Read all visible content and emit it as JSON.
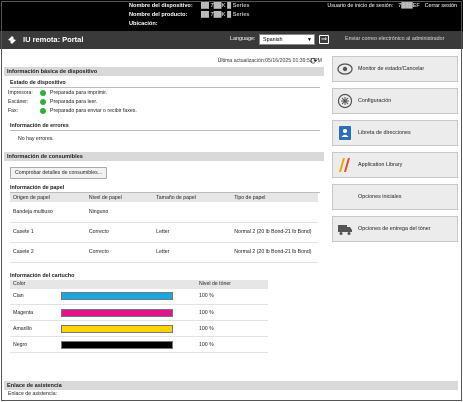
{
  "header": {
    "device_name_label": "Nombre del dispositivo:",
    "device_name_value": "██ 7██K █ Series",
    "product_name_label": "Nombre del producto:",
    "product_name_value": "██ 7██K █ Series",
    "location_label": "Ubicación:",
    "login_user_label": "Usuario de inicio de sesión:",
    "login_user_value": "7███EF",
    "logout_link": "Cerrar sesión"
  },
  "titlebar": {
    "title": "IU remota: Portal",
    "language_label": "Language:",
    "language_value": "Spanish",
    "mail_admin": "Enviar correo electrónico al administrador"
  },
  "update": {
    "text": "Última actualización:05/16/2025 01:39:51 PM"
  },
  "device_info": {
    "heading": "Información básica de dispositivo",
    "status_heading": "Estado de dispositivo",
    "rows": [
      {
        "label": "Impresora:",
        "value": "Preparada para imprimir."
      },
      {
        "label": "Escáner:",
        "value": "Preparada para leer."
      },
      {
        "label": "Fax:",
        "value": "Preparado para enviar o recibir faxes."
      }
    ],
    "errors_heading": "Información de errores",
    "errors_value": "No hay errores."
  },
  "consumables": {
    "heading": "Información de consumibles",
    "check_button": "Comprobar detalles de consumibles...",
    "paper_heading": "Información de papel",
    "paper_columns": [
      "Origen de papel",
      "Nivel de papel",
      "Tamaño de papel",
      "Tipo de papel"
    ],
    "paper_rows": [
      [
        "Bandeja multiuso",
        "Ninguno",
        "",
        ""
      ],
      [
        "Casete 1",
        "Correcto",
        "Letter",
        "Normal 2 (20 lb Bond-21 lb Bond)"
      ],
      [
        "Casete 2",
        "Correcto",
        "Letter",
        "Normal 2 (20 lb Bond-21 lb Bond)"
      ]
    ],
    "cartridge_heading": "Información del cartucho",
    "cartridge_columns": [
      "Color",
      "",
      "Nivel de tóner"
    ],
    "cartridges": [
      {
        "name": "Cian",
        "color": "#1aa7df",
        "level": "100 %"
      },
      {
        "name": "Magenta",
        "color": "#e0148c",
        "level": "100 %"
      },
      {
        "name": "Amarillo",
        "color": "#ffd200",
        "level": "100 %"
      },
      {
        "name": "Negro",
        "color": "#000000",
        "level": "100 %"
      }
    ]
  },
  "support": {
    "heading": "Enlace de asistencia",
    "label": "Enlace de asistencia:"
  },
  "side": {
    "items": [
      {
        "label": "Monitor de estado/Cancelar",
        "icon": "status-monitor-icon"
      },
      {
        "label": "Configuración",
        "icon": "settings-icon"
      },
      {
        "label": "Libreta de direcciones",
        "icon": "address-book-icon"
      },
      {
        "label": "Application Library",
        "icon": "application-library-icon"
      },
      {
        "label": "Opciones iniciales",
        "icon": ""
      },
      {
        "label": "Opciones de entrega del tóner",
        "icon": "toner-delivery-icon"
      }
    ]
  }
}
